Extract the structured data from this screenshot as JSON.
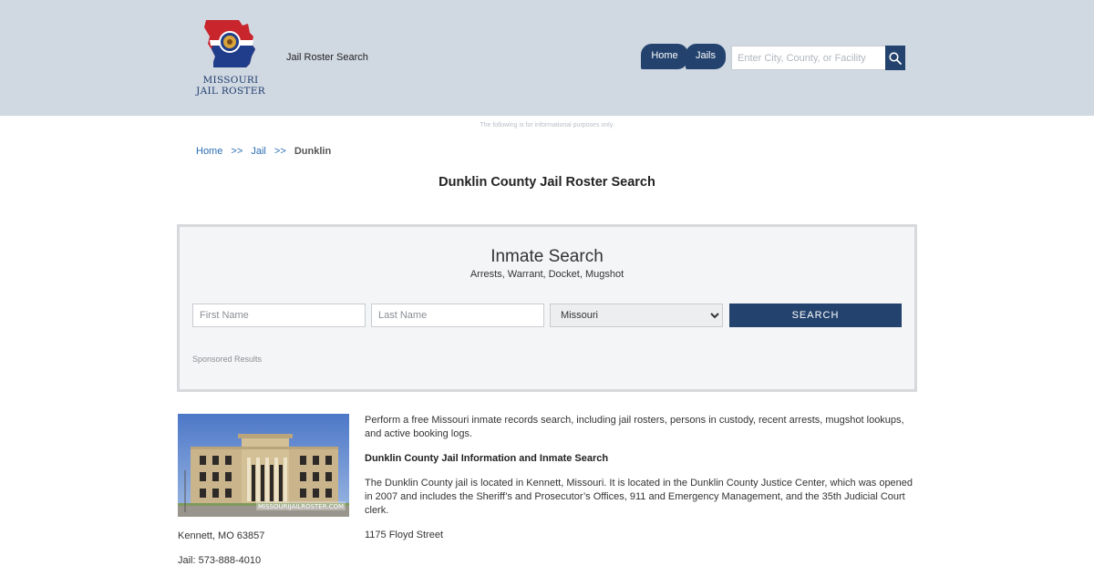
{
  "header": {
    "logo_line1": "MISSOURI",
    "logo_line2": "JAIL ROSTER",
    "site_name": "Jail Roster Search",
    "nav": {
      "home": "Home",
      "jails": "Jails"
    },
    "search_placeholder": "Enter City, County, or Facility",
    "search_icon": "magnifier-icon",
    "brand_color": "#23436e",
    "header_bg": "#d0d8e2"
  },
  "disclaimer": "The following is for informational purposes only.",
  "breadcrumb": {
    "home": "Home",
    "sep1": ">>",
    "jail": "Jail",
    "sep2": ">>",
    "current": "Dunklin"
  },
  "page_title": "Dunklin County Jail Roster Search",
  "inmate_search": {
    "title": "Inmate Search",
    "subtitle": "Arrests, Warrant, Docket, Mugshot",
    "first_name_placeholder": "First Name",
    "last_name_placeholder": "Last Name",
    "state_selected": "Missouri",
    "button": "SEARCH",
    "sponsored": "Sponsored Results"
  },
  "photo": {
    "watermark": "MISSOURIJAILROSTER.COM"
  },
  "content": {
    "intro": "Perform a free Missouri inmate records search, including jail rosters, persons in custody, recent arrests, mugshot lookups, and active booking logs.",
    "heading": "Dunklin County Jail Information and Inmate Search",
    "description": "The Dunklin County jail is located in Kennett, Missouri. It is located in the Dunklin County Justice Center, which was opened in 2007 and includes the Sheriff’s and Prosecutor’s Offices, 911 and Emergency Management, and the 35th Judicial Court clerk.",
    "street": "1175 Floyd Street"
  },
  "address": {
    "city": "Kennett, MO 63857",
    "phone": "Jail: 573-888-4010"
  }
}
